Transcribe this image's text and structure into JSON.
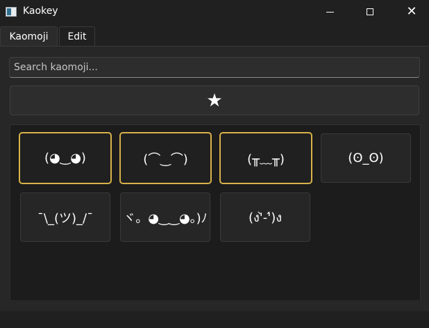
{
  "window": {
    "title": "Kaokey"
  },
  "controls": {
    "minimize": "–",
    "maximize": "□",
    "close": "✕"
  },
  "tabs": [
    {
      "label": "Kaomoji",
      "active": true
    },
    {
      "label": "Edit",
      "active": false
    }
  ],
  "search": {
    "placeholder": "Search kaomoji...",
    "value": ""
  },
  "favorites_button": {
    "glyph": "★"
  },
  "kaomoji": [
    {
      "text": "(◕‿◕)",
      "favorite": true
    },
    {
      "text": "(⌒‿⌒)",
      "favorite": true
    },
    {
      "text": "(╥﹏╥)",
      "favorite": true
    },
    {
      "text": "(ʘ_ʘ)",
      "favorite": false
    },
    {
      "text": "¯\\_(ツ)_/¯",
      "favorite": false
    },
    {
      "text": "ヾ。◕‿‿◕。)ﾉ",
      "favorite": false
    },
    {
      "text": "(ง'̀-'́)ง",
      "favorite": false
    }
  ],
  "colors": {
    "accent_favorite_border": "#d9b24a",
    "background": "#202020",
    "tile": "#262626"
  }
}
